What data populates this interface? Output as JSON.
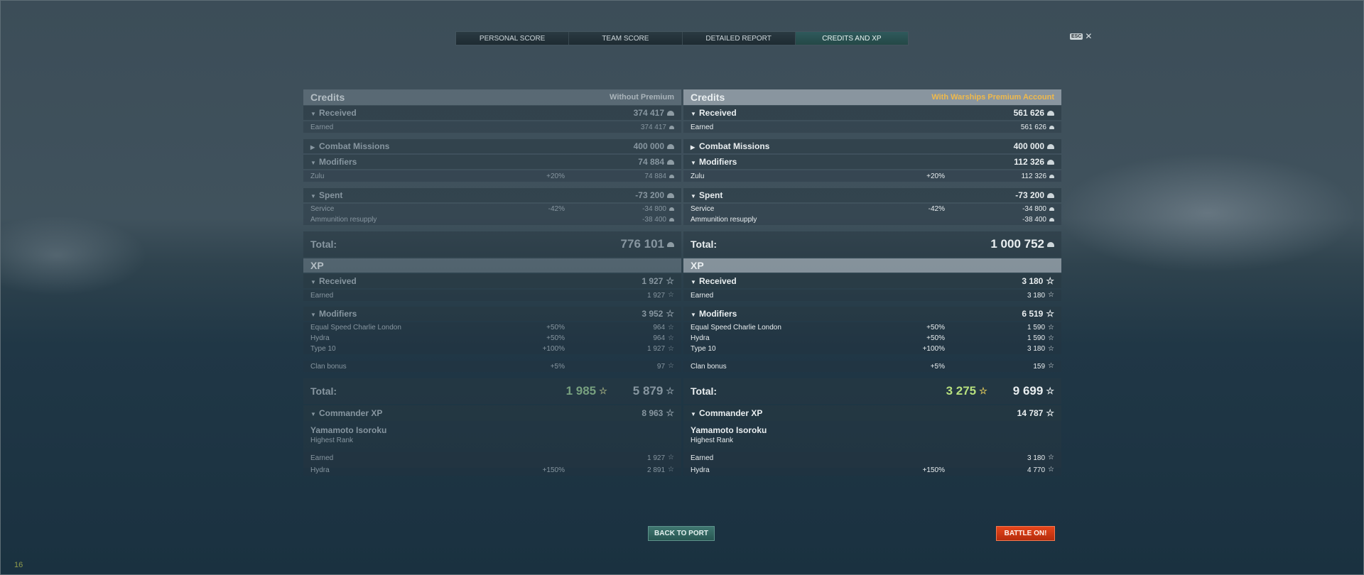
{
  "tabs": [
    {
      "label": "PERSONAL SCORE",
      "active": false
    },
    {
      "label": "TEAM SCORE",
      "active": false
    },
    {
      "label": "DETAILED REPORT",
      "active": false
    },
    {
      "label": "CREDITS AND XP",
      "active": true
    }
  ],
  "esc": {
    "key": "ESC",
    "close": "✕"
  },
  "left": {
    "credits_title": "Credits",
    "premium_label": "Without Premium",
    "received": {
      "label": "Received",
      "value": "374 417"
    },
    "earned": {
      "label": "Earned",
      "value": "374 417"
    },
    "combat_missions": {
      "label": "Combat Missions",
      "value": "400 000"
    },
    "modifiers": {
      "label": "Modifiers",
      "value": "74 884"
    },
    "zulu": {
      "label": "Zulu",
      "pct": "+20%",
      "value": "74 884"
    },
    "spent": {
      "label": "Spent",
      "value": "-73 200"
    },
    "service": {
      "label": "Service",
      "pct": "-42%",
      "value": "-34 800"
    },
    "ammo": {
      "label": "Ammunition resupply",
      "value": "-38 400"
    },
    "credits_total": {
      "label": "Total:",
      "value": "776 101"
    },
    "xp_title": "XP",
    "xp_received": {
      "label": "Received",
      "value": "1 927"
    },
    "xp_earned": {
      "label": "Earned",
      "value": "1 927"
    },
    "xp_modifiers": {
      "label": "Modifiers",
      "value": "3 952"
    },
    "escl": {
      "label": "Equal Speed Charlie London",
      "pct": "+50%",
      "value": "964"
    },
    "hydra": {
      "label": "Hydra",
      "pct": "+50%",
      "value": "964"
    },
    "type10": {
      "label": "Type 10",
      "pct": "+100%",
      "value": "1 927"
    },
    "clan": {
      "label": "Clan bonus",
      "pct": "+5%",
      "value": "97"
    },
    "xp_total": {
      "label": "Total:",
      "premium_value": "1 985",
      "value": "5 879"
    },
    "commander": {
      "label": "Commander XP",
      "value": "8 963"
    },
    "cmd_name": "Yamamoto Isoroku",
    "cmd_rank": "Highest Rank",
    "cmd_earned": {
      "label": "Earned",
      "value": "1 927"
    },
    "cmd_hydra": {
      "label": "Hydra",
      "pct": "+150%",
      "value": "2 891"
    }
  },
  "right": {
    "credits_title": "Credits",
    "premium_label": "With Warships Premium Account",
    "received": {
      "label": "Received",
      "value": "561 626"
    },
    "earned": {
      "label": "Earned",
      "value": "561 626"
    },
    "combat_missions": {
      "label": "Combat Missions",
      "value": "400 000"
    },
    "modifiers": {
      "label": "Modifiers",
      "value": "112 326"
    },
    "zulu": {
      "label": "Zulu",
      "pct": "+20%",
      "value": "112 326"
    },
    "spent": {
      "label": "Spent",
      "value": "-73 200"
    },
    "service": {
      "label": "Service",
      "pct": "-42%",
      "value": "-34 800"
    },
    "ammo": {
      "label": "Ammunition resupply",
      "value": "-38 400"
    },
    "credits_total": {
      "label": "Total:",
      "value": "1 000 752"
    },
    "xp_title": "XP",
    "xp_received": {
      "label": "Received",
      "value": "3 180"
    },
    "xp_earned": {
      "label": "Earned",
      "value": "3 180"
    },
    "xp_modifiers": {
      "label": "Modifiers",
      "value": "6 519"
    },
    "escl": {
      "label": "Equal Speed Charlie London",
      "pct": "+50%",
      "value": "1 590"
    },
    "hydra": {
      "label": "Hydra",
      "pct": "+50%",
      "value": "1 590"
    },
    "type10": {
      "label": "Type 10",
      "pct": "+100%",
      "value": "3 180"
    },
    "clan": {
      "label": "Clan bonus",
      "pct": "+5%",
      "value": "159"
    },
    "xp_total": {
      "label": "Total:",
      "premium_value": "3 275",
      "value": "9 699"
    },
    "commander": {
      "label": "Commander XP",
      "value": "14 787"
    },
    "cmd_name": "Yamamoto Isoroku",
    "cmd_rank": "Highest Rank",
    "cmd_earned": {
      "label": "Earned",
      "value": "3 180"
    },
    "cmd_hydra": {
      "label": "Hydra",
      "pct": "+150%",
      "value": "4 770"
    }
  },
  "buttons": {
    "back_to_port": "BACK TO PORT",
    "battle": "BATTLE ON!"
  },
  "corner_text": "16"
}
